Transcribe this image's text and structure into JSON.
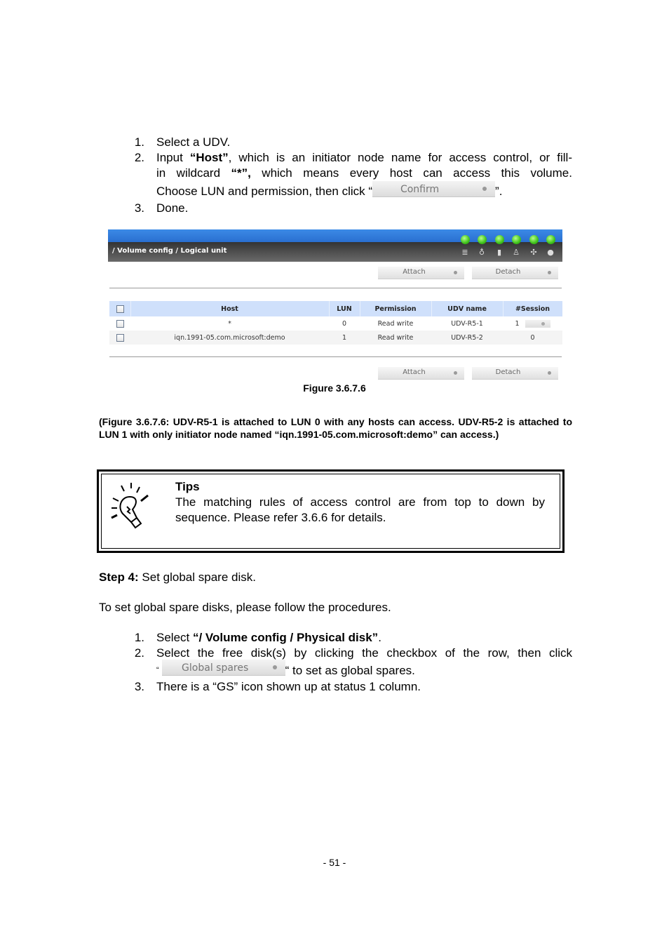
{
  "steps_a": [
    {
      "num": "1.",
      "text": "Select a UDV."
    },
    {
      "num": "2.",
      "line1_pre": "Input ",
      "line1_bold": "“Host”",
      "line1_post": ", which is an initiator node name for access control, or fill-",
      "line2_pre": "in wildcard ",
      "line2_bold": "“*”,",
      "line2_post": " which means every host can access this volume.",
      "line3_pre": "Choose LUN and permission, then click “",
      "line3_post": "”.",
      "button_label": "Confirm"
    },
    {
      "num": "3.",
      "text": "Done."
    }
  ],
  "figure": {
    "breadcrumb": "/ Volume config / Logical unit",
    "status_icons": [
      "disk-stack-icon",
      "temperature-icon",
      "battery-icon",
      "power-supply-icon",
      "fan-icon",
      "power-icon"
    ],
    "led_color": "#3fc21a",
    "buttons": {
      "attach": "Attach",
      "detach": "Detach"
    },
    "table": {
      "headers": [
        "Host",
        "LUN",
        "Permission",
        "UDV name",
        "#Session"
      ],
      "rows": [
        {
          "host": "*",
          "lun": "0",
          "permission": "Read write",
          "udv": "UDV-R5-1",
          "session": "1"
        },
        {
          "host": "iqn.1991-05.com.microsoft:demo",
          "lun": "1",
          "permission": "Read write",
          "udv": "UDV-R5-2",
          "session": "0"
        }
      ]
    },
    "caption": "Figure 3.6.7.6"
  },
  "figure_note": "(Figure 3.6.7.6: UDV-R5-1 is attached to LUN 0 with any hosts can access. UDV-R5-2 is attached to LUN 1 with only initiator node named “iqn.1991-05.com.microsoft:demo” can access.)",
  "tips": {
    "title": "Tips",
    "body": "The matching rules of access control are from top to down by sequence. Please refer 3.6.6 for details."
  },
  "step4": {
    "label": "Step 4:",
    "text": " Set global spare disk."
  },
  "intro": "To set global spare disks, please follow the procedures.",
  "steps_b": [
    {
      "num": "1.",
      "pre": "Select ",
      "bold": "“/ Volume config / Physical disk”",
      "post": "."
    },
    {
      "num": "2.",
      "line1": "Select the free disk(s) by clicking the checkbox of the row, then click",
      "line2_pre": "“",
      "button_label": "Global spares",
      "line2_post": "“ to set as global spares."
    },
    {
      "num": "3.",
      "text": "There is a “GS” icon shown up at status 1 column."
    }
  ],
  "page_number": "- 51 -"
}
